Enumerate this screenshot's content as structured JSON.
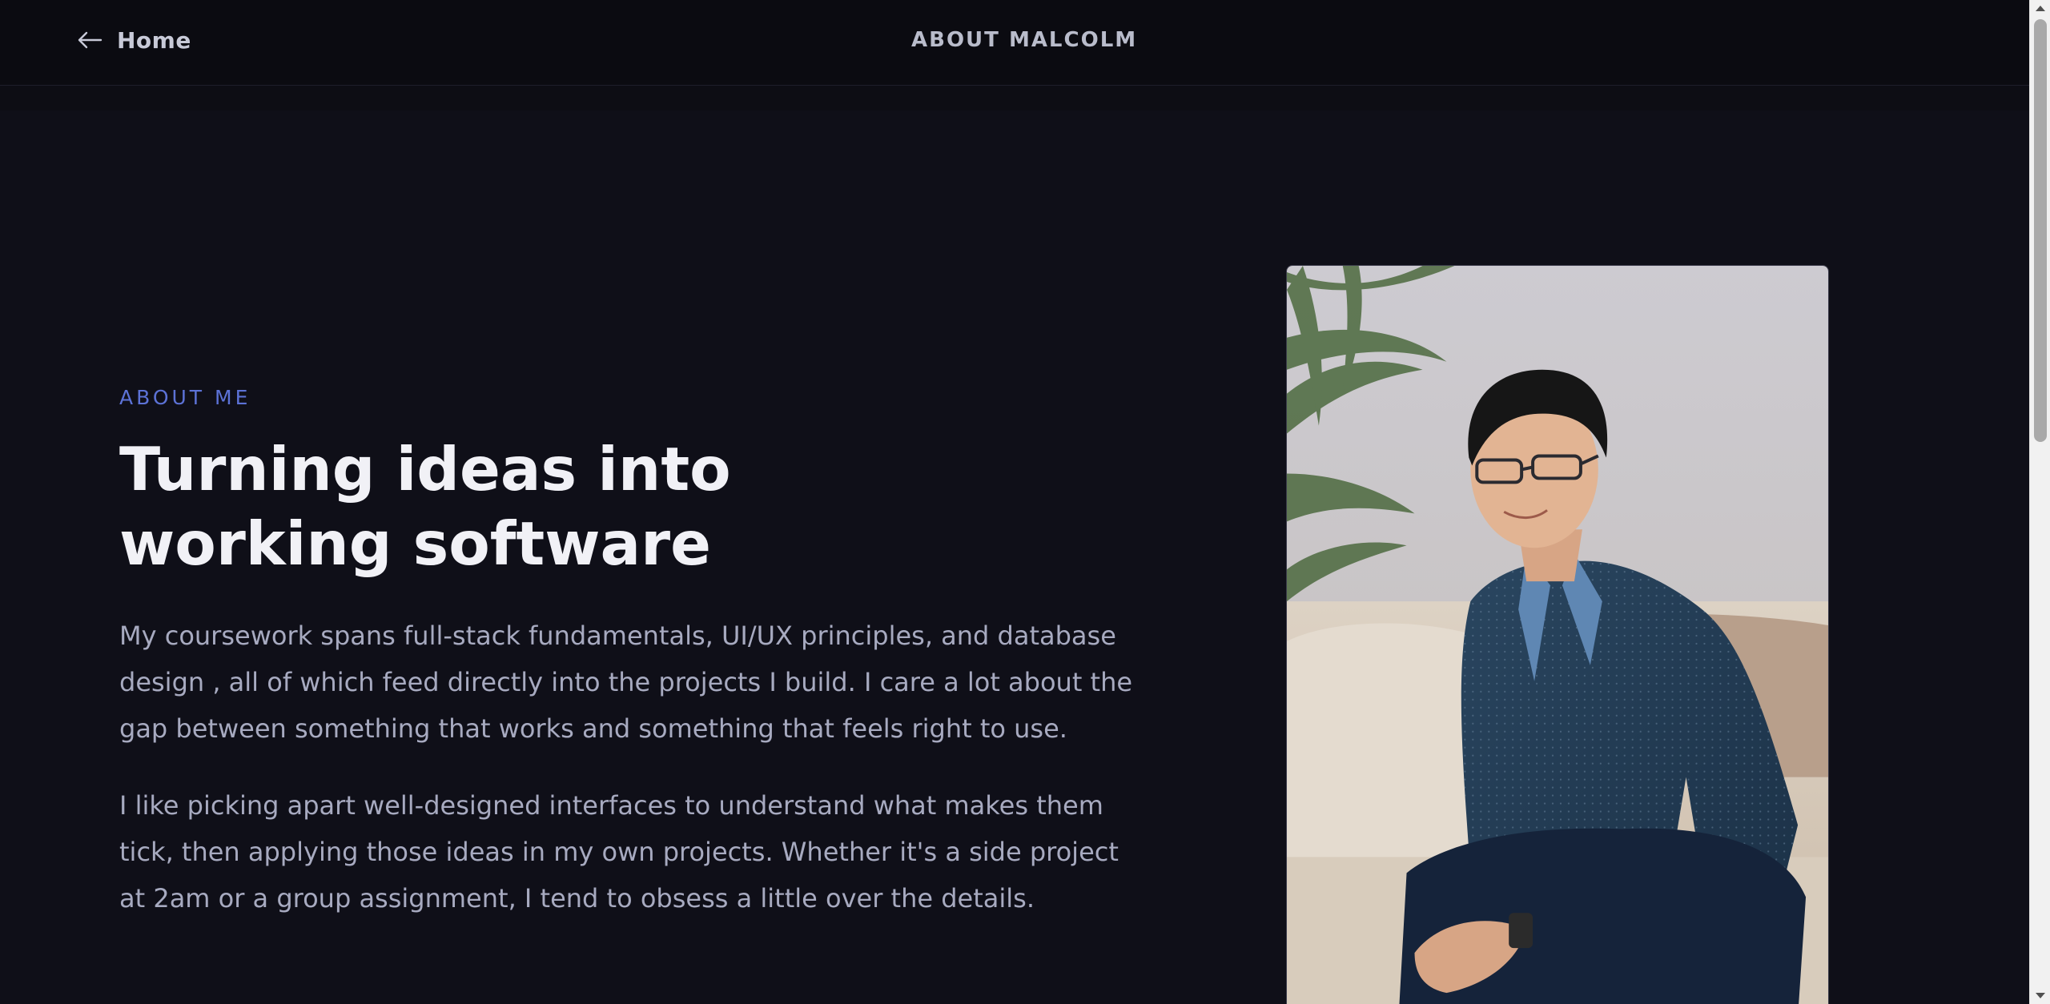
{
  "header": {
    "back_label": "Home",
    "back_icon": "arrow-left-icon",
    "title": "ABOUT MALCOLM"
  },
  "hero": {
    "eyebrow": "ABOUT ME",
    "headline_line1": "Turning ideas into",
    "headline_line2": "working software",
    "paragraph1": "My coursework spans full-stack fundamentals, UI/UX principles, and database design , all of which feed directly into the projects I build. I care a lot about the gap between something that works and something that feels right to use.",
    "paragraph2": "I like picking apart well-designed interfaces to understand what makes them tick, then applying those ideas in my own projects. Whether it's a side project at 2am or a group assignment, I tend to obsess a little over the details."
  },
  "colors": {
    "background": "#0f0f18",
    "header_background": "#0b0b11",
    "accent": "#5c72d6",
    "heading": "#f1f1f6",
    "body_text": "#a7aac0"
  }
}
